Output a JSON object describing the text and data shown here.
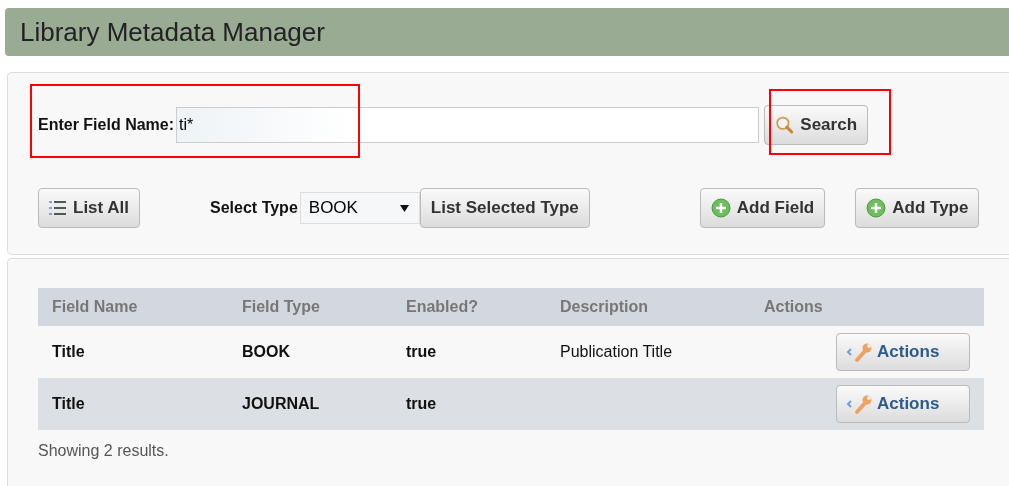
{
  "header": {
    "title": "Library Metadata Manager"
  },
  "search": {
    "label": "Enter Field Name:",
    "value": "ti*",
    "button": "Search"
  },
  "toolbar": {
    "list_all": "List All",
    "select_label": "Select Type",
    "select_value": "BOOK",
    "list_selected": "List Selected Type",
    "add_field": "Add Field",
    "add_type": "Add Type"
  },
  "table": {
    "columns": [
      "Field Name",
      "Field Type",
      "Enabled?",
      "Description",
      "Actions"
    ],
    "rows": [
      {
        "name": "Title",
        "type": "BOOK",
        "enabled": "true",
        "description": "Publication Title",
        "action": "Actions"
      },
      {
        "name": "Title",
        "type": "JOURNAL",
        "enabled": "true",
        "description": "",
        "action": "Actions"
      }
    ]
  },
  "footer": "Showing 2 results."
}
